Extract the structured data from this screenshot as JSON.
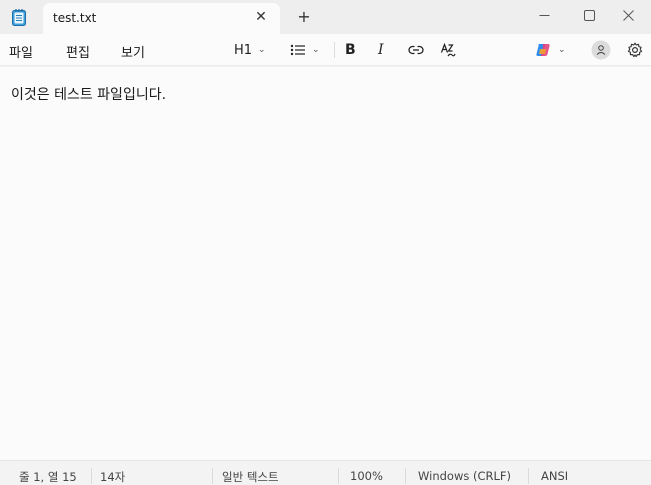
{
  "window": {
    "tab_title": "test.txt",
    "tab_close_glyph": "✕",
    "new_tab_glyph": "+"
  },
  "menu": {
    "items": [
      "파일",
      "편집",
      "보기"
    ]
  },
  "toolbar": {
    "heading_label": "H1",
    "icons": {
      "list": "list-icon",
      "bold": "bold-icon",
      "italic": "italic-icon",
      "link": "link-icon",
      "clear_format": "clear-formatting-icon",
      "copilot": "copilot-icon",
      "account": "account-icon",
      "settings": "gear-icon"
    },
    "bold_glyph": "B",
    "italic_glyph": "I"
  },
  "editor": {
    "content": "이것은 테스트 파일입니다."
  },
  "status": {
    "position": "줄 1, 열 15",
    "char_count": "14자",
    "format": "일반 텍스트",
    "zoom": "100%",
    "line_ending": "Windows (CRLF)",
    "encoding": "ANSI"
  },
  "colors": {
    "accent": "#1f66c4"
  }
}
